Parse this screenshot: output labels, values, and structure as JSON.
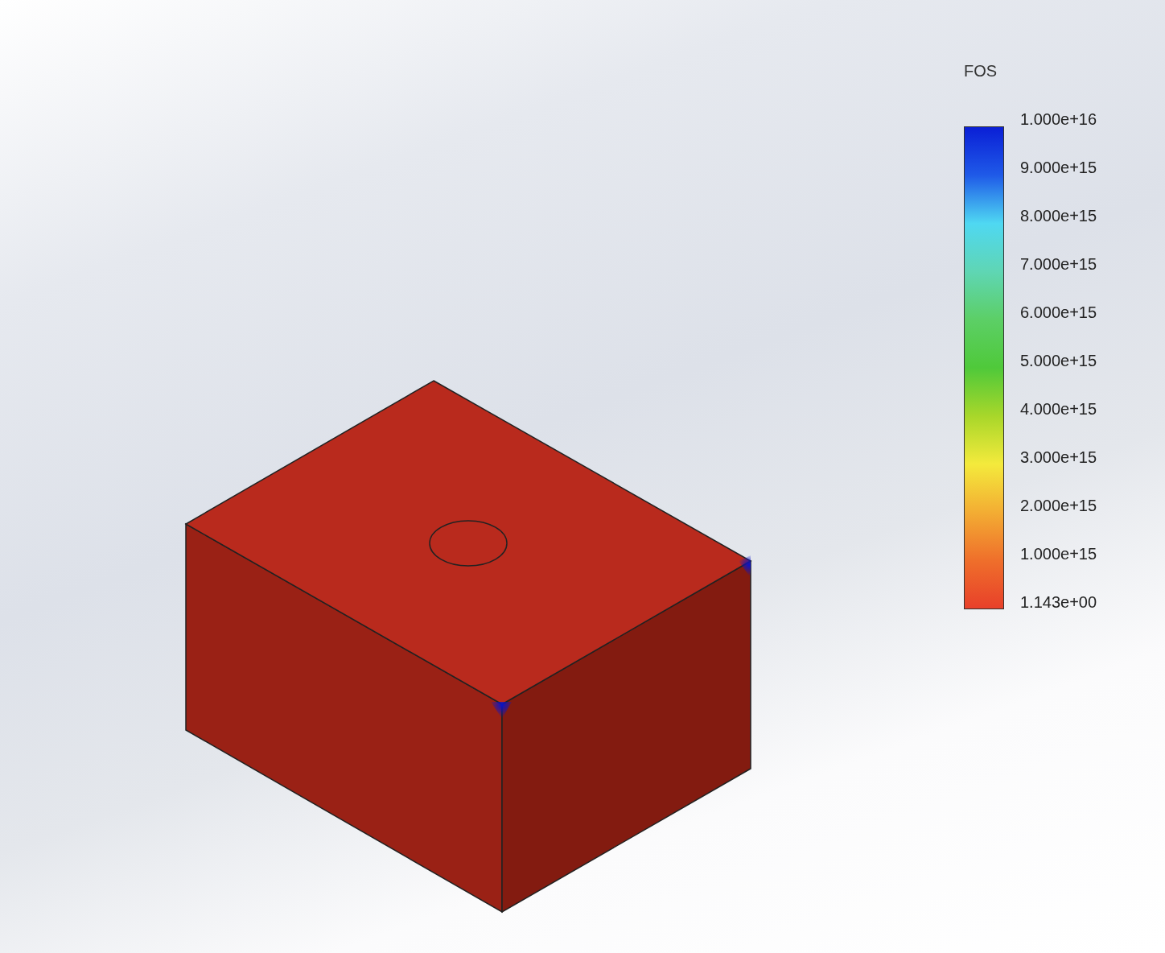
{
  "legend": {
    "title": "FOS",
    "labels": [
      "1.000e+16",
      "9.000e+15",
      "8.000e+15",
      "7.000e+15",
      "6.000e+15",
      "5.000e+15",
      "4.000e+15",
      "3.000e+15",
      "2.000e+15",
      "1.000e+15",
      "1.143e+00"
    ]
  }
}
